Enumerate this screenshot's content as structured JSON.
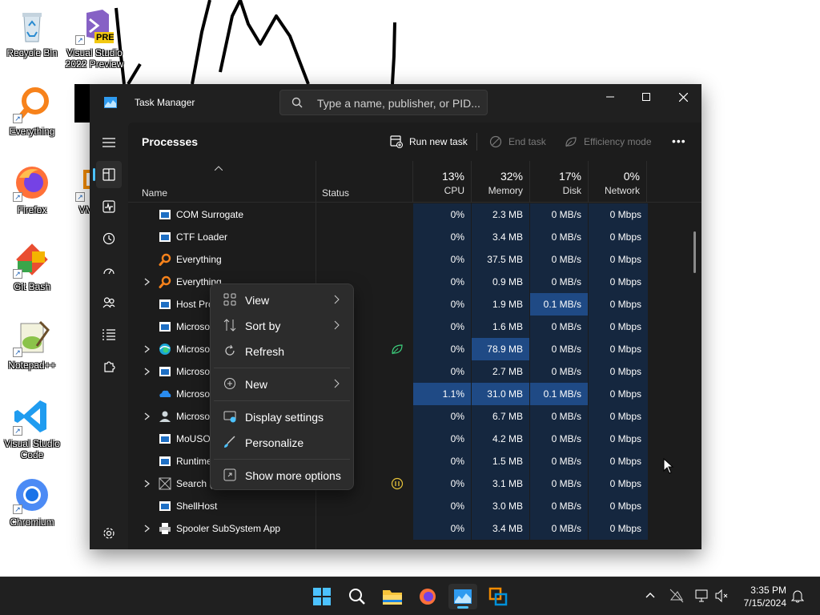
{
  "desktop": {
    "icons": [
      {
        "label": "Recycle Bin",
        "icon": "recycle-bin-icon"
      },
      {
        "label": "Visual Studio 2022 Preview",
        "badge": "PRE",
        "icon": "visual-studio-icon"
      },
      {
        "label": "Everything",
        "icon": "everything-icon"
      },
      {
        "label": "Firefox",
        "icon": "firefox-icon"
      },
      {
        "label": "Git Bash",
        "icon": "git-icon"
      },
      {
        "label": "Notepad++",
        "icon": "notepadpp-icon"
      },
      {
        "label": "Visual Studio Code",
        "icon": "vscode-icon"
      },
      {
        "label": "Chromium",
        "icon": "chromium-icon"
      },
      {
        "label": "VM Wo",
        "icon": "vmware-icon"
      }
    ]
  },
  "window": {
    "title": "Task Manager",
    "search_placeholder": "Type a name, publisher, or PID...",
    "controls": {
      "minimize": "minimize-icon",
      "maximize": "maximize-icon",
      "close": "close-icon"
    }
  },
  "sidebar": {
    "items": [
      "processes",
      "performance",
      "app-history",
      "startup-apps",
      "users",
      "details",
      "services"
    ],
    "bottom": "settings"
  },
  "toolbar": {
    "page_title": "Processes",
    "run_new_task": "Run new task",
    "end_task": "End task",
    "efficiency_mode": "Efficiency mode",
    "more": "•••"
  },
  "columns": {
    "name": "Name",
    "status": "Status",
    "cpu": {
      "pct": "13%",
      "label": "CPU"
    },
    "memory": {
      "pct": "32%",
      "label": "Memory"
    },
    "disk": {
      "pct": "17%",
      "label": "Disk"
    },
    "network": {
      "pct": "0%",
      "label": "Network"
    }
  },
  "processes": [
    {
      "name": "COM Surrogate",
      "cpu": "0%",
      "mem": "2.3 MB",
      "disk": "0 MB/s",
      "net": "0 Mbps",
      "icon": "window-icon",
      "expand": false
    },
    {
      "name": "CTF Loader",
      "cpu": "0%",
      "mem": "3.4 MB",
      "disk": "0 MB/s",
      "net": "0 Mbps",
      "icon": "window-icon",
      "expand": false
    },
    {
      "name": "Everything",
      "cpu": "0%",
      "mem": "37.5 MB",
      "disk": "0 MB/s",
      "net": "0 Mbps",
      "icon": "everything-icon",
      "expand": false
    },
    {
      "name": "Everything",
      "cpu": "0%",
      "mem": "0.9 MB",
      "disk": "0 MB/s",
      "net": "0 Mbps",
      "icon": "everything-icon",
      "expand": true
    },
    {
      "name": "Host Pro",
      "cpu": "0%",
      "mem": "1.9 MB",
      "disk": "0.1 MB/s",
      "net": "0 Mbps",
      "icon": "window-icon",
      "expand": false,
      "disk_hl": true
    },
    {
      "name": "Microso",
      "cpu": "0%",
      "mem": "1.6 MB",
      "disk": "0 MB/s",
      "net": "0 Mbps",
      "icon": "window-icon",
      "expand": false
    },
    {
      "name": "Microso",
      "cpu": "0%",
      "mem": "78.9 MB",
      "disk": "0 MB/s",
      "net": "0 Mbps",
      "icon": "edge-icon",
      "expand": true,
      "mem_hl": true,
      "status": "leaf"
    },
    {
      "name": "Microso",
      "cpu": "0%",
      "mem": "2.7 MB",
      "disk": "0 MB/s",
      "net": "0 Mbps",
      "icon": "window-icon",
      "expand": true
    },
    {
      "name": "Microso",
      "cpu": "1.1%",
      "mem": "31.0 MB",
      "disk": "0.1 MB/s",
      "net": "0 Mbps",
      "icon": "onedrive-icon",
      "expand": false,
      "cpu_hl": true,
      "mem_hl": true,
      "disk_hl": true
    },
    {
      "name": "Microso",
      "cpu": "0%",
      "mem": "6.7 MB",
      "disk": "0 MB/s",
      "net": "0 Mbps",
      "icon": "user-icon",
      "expand": true
    },
    {
      "name": "MoUSO",
      "cpu": "0%",
      "mem": "4.2 MB",
      "disk": "0 MB/s",
      "net": "0 Mbps",
      "icon": "window-icon",
      "expand": false
    },
    {
      "name": "Runtime",
      "cpu": "0%",
      "mem": "1.5 MB",
      "disk": "0 MB/s",
      "net": "0 Mbps",
      "icon": "window-icon",
      "expand": false
    },
    {
      "name": "Search (",
      "cpu": "0%",
      "mem": "3.1 MB",
      "disk": "0 MB/s",
      "net": "0 Mbps",
      "icon": "search-app-icon",
      "expand": true,
      "status": "pause"
    },
    {
      "name": "ShellHost",
      "cpu": "0%",
      "mem": "3.0 MB",
      "disk": "0 MB/s",
      "net": "0 Mbps",
      "icon": "window-icon",
      "expand": false
    },
    {
      "name": "Spooler SubSystem App",
      "cpu": "0%",
      "mem": "3.4 MB",
      "disk": "0 MB/s",
      "net": "0 Mbps",
      "icon": "printer-icon",
      "expand": true
    }
  ],
  "context_menu": {
    "items": [
      {
        "label": "View",
        "icon": "view-grid-icon",
        "submenu": true
      },
      {
        "label": "Sort by",
        "icon": "sort-icon",
        "submenu": true
      },
      {
        "label": "Refresh",
        "icon": "refresh-icon",
        "submenu": false
      },
      {
        "label": "New",
        "icon": "new-plus-icon",
        "submenu": true
      },
      {
        "label": "Display settings",
        "icon": "display-settings-icon",
        "submenu": false
      },
      {
        "label": "Personalize",
        "icon": "brush-icon",
        "submenu": false
      },
      {
        "label": "Show more options",
        "icon": "more-options-icon",
        "submenu": false
      }
    ]
  },
  "taskbar": {
    "time": "3:35 PM",
    "date": "7/15/2024",
    "apps": [
      "start-icon",
      "search-icon",
      "file-explorer-icon",
      "firefox-icon",
      "task-manager-icon",
      "vmware-icon"
    ]
  },
  "colors": {
    "accent": "#4cc2ff",
    "highlight_low": "#15273f",
    "highlight_mid": "#1a3660",
    "highlight_high": "#1f4a85"
  }
}
